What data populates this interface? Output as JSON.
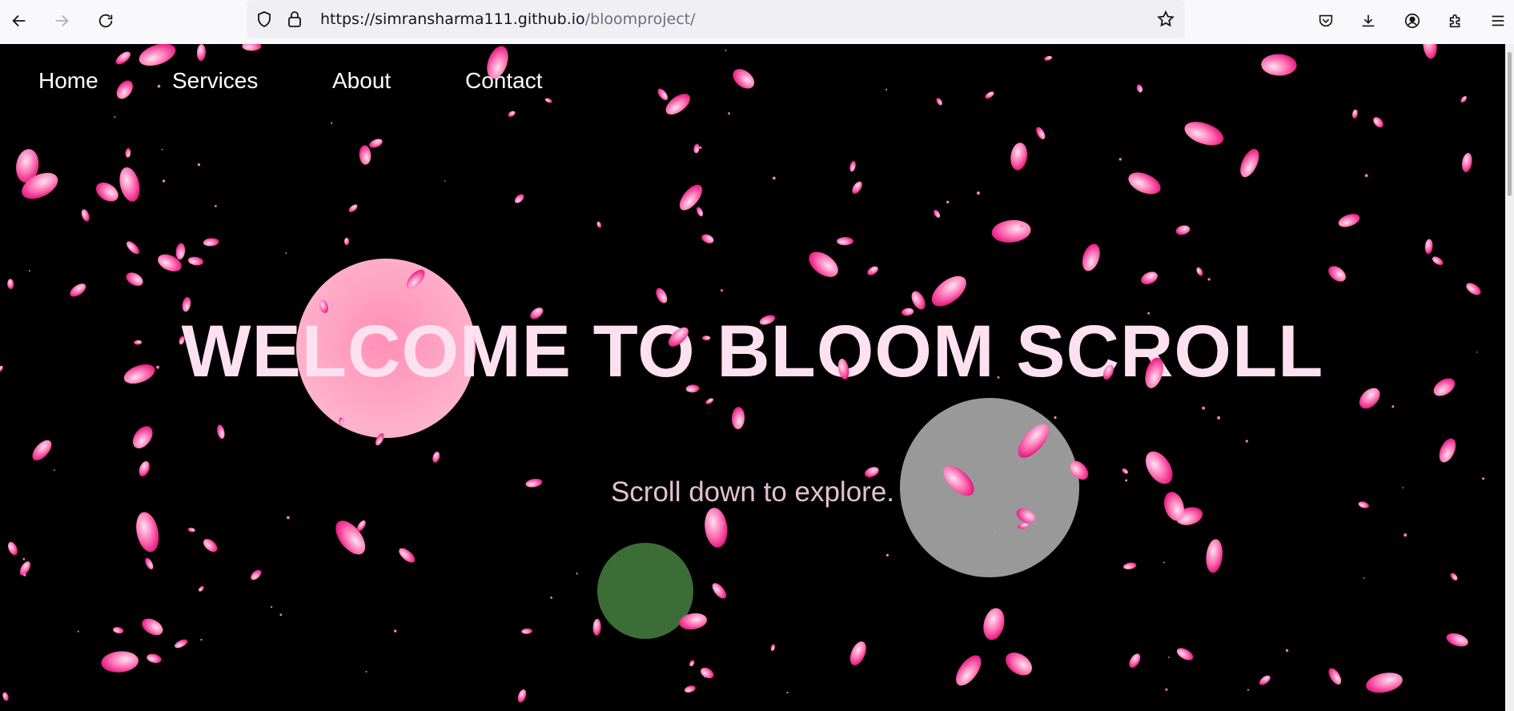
{
  "browser": {
    "url_host": "https://simransharma111.github.io",
    "url_path": "/bloomproject/",
    "icons": [
      "back-arrow-icon",
      "forward-arrow-icon",
      "reload-icon",
      "shield-icon",
      "lock-icon",
      "bookmark-star-icon",
      "pocket-icon",
      "download-icon",
      "account-icon",
      "extensions-icon",
      "menu-icon"
    ]
  },
  "nav": {
    "items": [
      {
        "label": "Home"
      },
      {
        "label": "Services"
      },
      {
        "label": "About"
      },
      {
        "label": "Contact"
      }
    ]
  },
  "hero": {
    "title": "WELCOME TO BLOOM SCROLL",
    "subtitle": "Scroll down to explore."
  },
  "colors": {
    "background": "#000000",
    "title": "#fde1f0",
    "subtitle": "#e2c0d2",
    "petal": "#ff4fa3",
    "bubble_pink": "#ffa7c4",
    "bubble_gray": "#999999",
    "bubble_green": "#3c6d36"
  }
}
